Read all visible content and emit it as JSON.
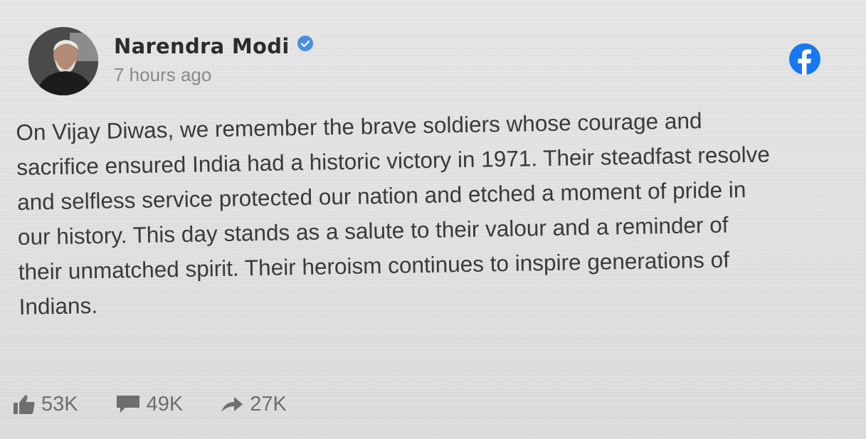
{
  "post": {
    "author": "Narendra Modi",
    "verified": true,
    "time": "7 hours ago",
    "text_lines": [
      "On Vijay Diwas, we remember the brave soldiers whose courage and",
      "sacrifice ensured India had a historic victory in 1971. Their steadfast resolve",
      "and selfless service protected our nation and etched a moment of pride in",
      "our history. This day stands as a salute to their valour and a reminder of",
      "their unmatched spirit. Their heroism continues to inspire generations of",
      "Indians."
    ]
  },
  "stats": {
    "likes": "53K",
    "comments": "49K",
    "shares": "27K"
  },
  "icons": {
    "platform": "facebook-icon",
    "verified": "verified-badge-icon",
    "like": "thumbs-up-icon",
    "comment": "comment-icon",
    "share": "share-arrow-icon"
  },
  "colors": {
    "facebook_blue": "#1877f2",
    "verified_blue": "#4a8ce0"
  }
}
